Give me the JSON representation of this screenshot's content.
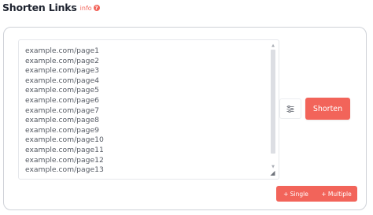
{
  "header": {
    "title": "Shorten Links",
    "info_label": "info",
    "info_badge": "?"
  },
  "editor": {
    "lines": [
      "example.com/page1",
      "example.com/page2",
      "example.com/page3",
      "example.com/page4",
      "example.com/page5",
      "example.com/page6",
      "example.com/page7",
      "example.com/page8",
      "example.com/page9",
      "example.com/page10",
      "example.com/page11",
      "example.com/page12",
      "example.com/page13"
    ]
  },
  "actions": {
    "shorten_label": "Shorten",
    "single_label": "+ Single",
    "multiple_label": "+ Multiple"
  },
  "icons": {
    "info": "question-mark-icon",
    "settings": "sliders-icon",
    "resize": "resize-handle-icon"
  },
  "colors": {
    "accent": "#f2645a",
    "text": "#555a63",
    "title": "#1f2430"
  }
}
